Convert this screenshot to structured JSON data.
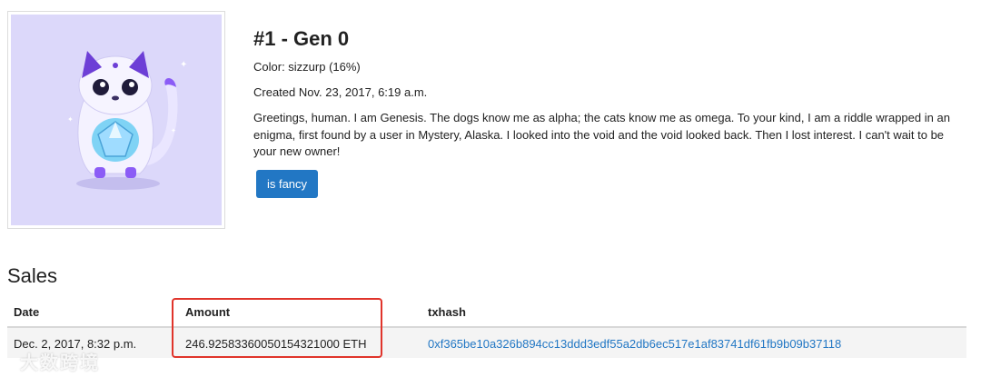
{
  "kitty": {
    "title": "#1 - Gen 0",
    "color_label": "Color: sizzurp (16%)",
    "created": "Created Nov. 23, 2017, 6:19 a.m.",
    "bio": "Greetings, human. I am Genesis. The dogs know me as alpha; the cats know me as omega. To your kind, I am a riddle wrapped in an enigma, first found by a user in Mystery, Alaska. I looked into the void and the void looked back. Then I lost interest. I can't wait to be your new owner!",
    "fancy_label": "is fancy",
    "image_bg_color": "#dcd8fa"
  },
  "sales": {
    "heading": "Sales",
    "columns": [
      "Date",
      "Amount",
      "txhash"
    ],
    "rows": [
      {
        "date": "Dec. 2, 2017, 8:32 p.m.",
        "amount": "246.92583360050154321000 ETH",
        "txhash": "0xf365be10a326b894cc13ddd3edf55a2db6ec517e1af83741df61fb9b09b37118"
      }
    ]
  },
  "watermark": "大数跨境",
  "colors": {
    "accent": "#2277c4",
    "highlight": "#e0342b"
  }
}
